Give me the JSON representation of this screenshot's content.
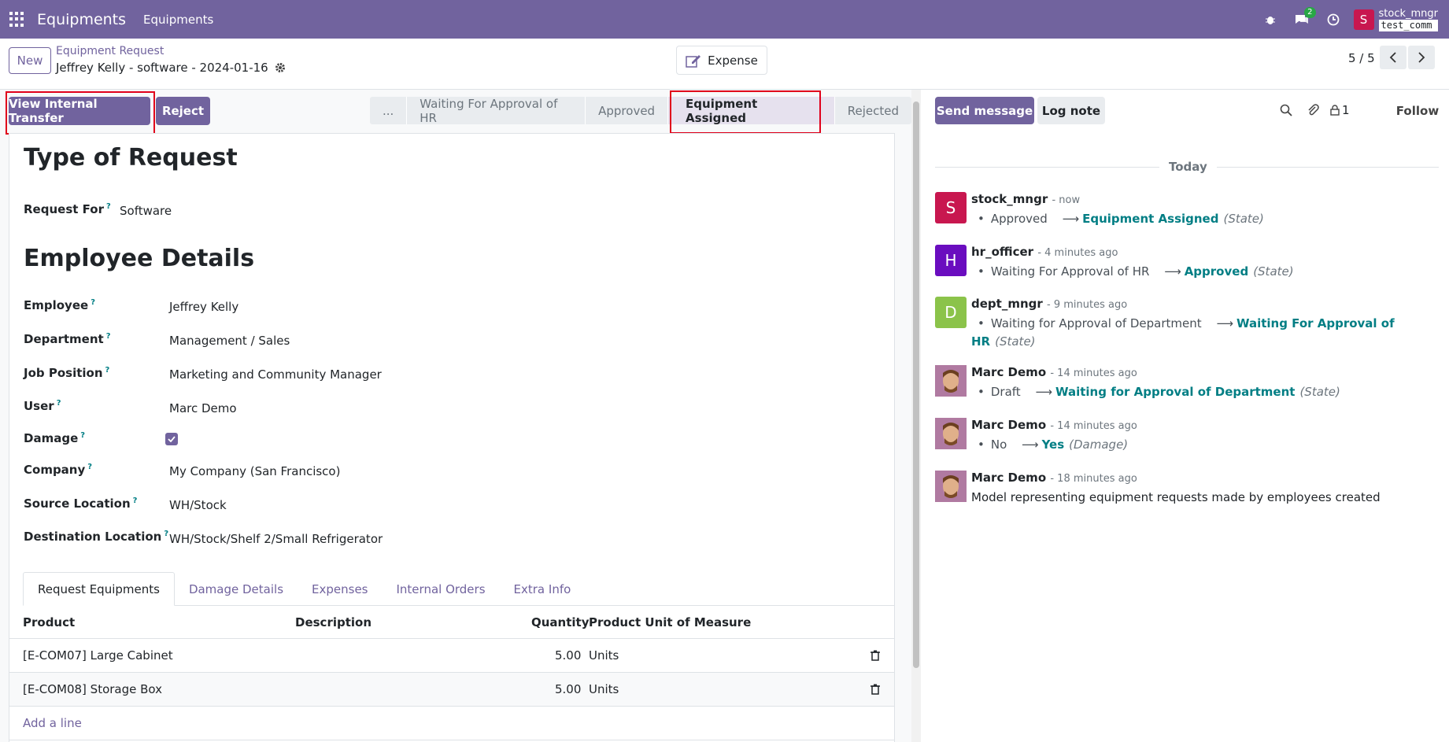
{
  "navbar": {
    "app_name": "Equipments",
    "menu": [
      "Equipments"
    ],
    "chat_badge": "2",
    "user_avatar_letter": "S",
    "user_name": "stock_mngr",
    "database": "test_comm"
  },
  "control": {
    "new_label": "New",
    "breadcrumb": "Equipment Request",
    "record_title": "Jeffrey Kelly - software - 2024-01-16",
    "expense_label": "Expense",
    "pager": "5 / 5"
  },
  "actions": {
    "view_transfer": "View Internal Transfer",
    "reject": "Reject"
  },
  "statusbar": {
    "more": "...",
    "items": [
      "Waiting For Approval of HR",
      "Approved",
      "Equipment Assigned",
      "Rejected"
    ],
    "active_index": 2
  },
  "form": {
    "type_heading": "Type of Request",
    "request_for_label": "Request For",
    "request_for_value": "Software",
    "employee_heading": "Employee Details",
    "fields": [
      {
        "label": "Employee",
        "value": "Jeffrey Kelly"
      },
      {
        "label": "Department",
        "value": "Management / Sales"
      },
      {
        "label": "Job Position",
        "value": "Marketing and Community Manager"
      },
      {
        "label": "User",
        "value": "Marc Demo"
      },
      {
        "label": "Damage",
        "value": ""
      },
      {
        "label": "Company",
        "value": "My Company (San Francisco)"
      },
      {
        "label": "Source Location",
        "value": "WH/Stock"
      },
      {
        "label": "Destination Location",
        "value": "WH/Stock/Shelf 2/Small Refrigerator"
      }
    ],
    "damage_checked": true,
    "help_mark": "?"
  },
  "tabs": [
    "Request Equipments",
    "Damage Details",
    "Expenses",
    "Internal Orders",
    "Extra Info"
  ],
  "table": {
    "headers": {
      "product": "Product",
      "description": "Description",
      "quantity": "Quantity",
      "uom": "Product Unit of Measure"
    },
    "rows": [
      {
        "product": "[E-COM07] Large Cabinet",
        "description": "",
        "quantity": "5.00",
        "uom": "Units"
      },
      {
        "product": "[E-COM08] Storage Box",
        "description": "",
        "quantity": "5.00",
        "uom": "Units"
      }
    ],
    "add_line": "Add a line"
  },
  "chatter": {
    "send_message": "Send message",
    "log_note": "Log note",
    "followers_count": "1",
    "follow": "Follow",
    "today": "Today",
    "messages": [
      {
        "author": "stock_mngr",
        "time": "- now",
        "avatar": "S",
        "color": "#c8174f",
        "old": "Approved",
        "new": "Equipment Assigned",
        "field": "(State)"
      },
      {
        "author": "hr_officer",
        "time": "- 4 minutes ago",
        "avatar": "H",
        "color": "#6a0dbf",
        "old": "Waiting For Approval of HR",
        "new": "Approved",
        "field": "(State)"
      },
      {
        "author": "dept_mngr",
        "time": "- 9 minutes ago",
        "avatar": "D",
        "color": "#8bc34a",
        "old": "Waiting for Approval of Department",
        "new": "Waiting For Approval of HR",
        "field": "(State)"
      },
      {
        "author": "Marc Demo",
        "time": "- 14 minutes ago",
        "avatar": "",
        "color": "#a26b8e",
        "old": "Draft",
        "new": "Waiting for Approval of Department",
        "field": "(State)"
      },
      {
        "author": "Marc Demo",
        "time": "- 14 minutes ago",
        "avatar": "",
        "color": "#a26b8e",
        "old": "No",
        "new": "Yes",
        "field": "(Damage)"
      },
      {
        "author": "Marc Demo",
        "time": "- 18 minutes ago",
        "avatar": "",
        "color": "#a26b8e",
        "body": "Model representing equipment requests made by employees created"
      }
    ]
  },
  "colors": {
    "brand": "#71639e",
    "link": "#017e84",
    "highlight": "#e0001b"
  }
}
